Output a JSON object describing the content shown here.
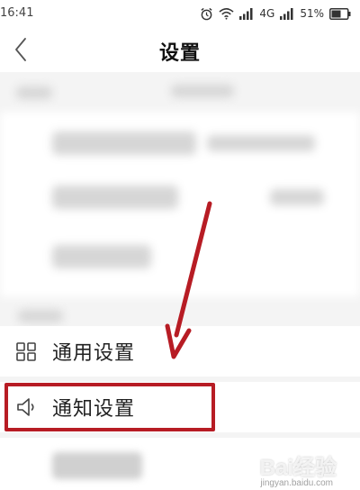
{
  "status_bar": {
    "time": "16:41",
    "network": "4G",
    "battery": "51%",
    "icons": [
      "alarm-icon",
      "wifi-icon",
      "signal-icon",
      "battery-icon"
    ]
  },
  "header": {
    "title": "设置",
    "back_icon": "chevron-left-icon"
  },
  "settings": {
    "items": [
      {
        "label": "通用设置",
        "icon": "grid-icon"
      },
      {
        "label": "通知设置",
        "icon": "speaker-icon"
      }
    ]
  },
  "annotation": {
    "highlight_color": "#b71c24"
  },
  "watermark": {
    "text": "Bai经验",
    "sub": "jingyan.baidu.com"
  }
}
